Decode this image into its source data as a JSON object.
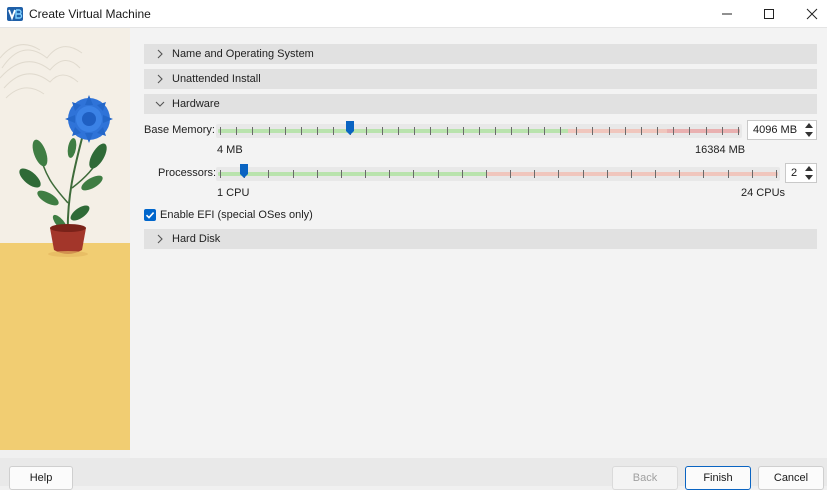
{
  "window": {
    "title": "Create Virtual Machine",
    "controls": [
      "minimize-icon",
      "maximize-icon",
      "close-icon"
    ]
  },
  "sections": {
    "name_os": {
      "label": "Name and Operating System",
      "expanded": false
    },
    "unattended": {
      "label": "Unattended Install",
      "expanded": false
    },
    "hardware": {
      "label": "Hardware",
      "expanded": true
    },
    "hard_disk": {
      "label": "Hard Disk",
      "expanded": false
    }
  },
  "hardware": {
    "base_memory": {
      "label": "Base Memory:",
      "value": "4096 MB",
      "min_label": "4 MB",
      "max_label": "16384 MB",
      "fraction": 0.25
    },
    "processors": {
      "label": "Processors:",
      "value": "2",
      "min_label": "1 CPU",
      "max_label": "24 CPUs",
      "fraction": 0.0435
    },
    "efi": {
      "label": "Enable EFI (special OSes only)",
      "checked": true
    }
  },
  "buttons": {
    "help": "Help",
    "back": "Back",
    "finish": "Finish",
    "cancel": "Cancel"
  },
  "colors": {
    "accent": "#0066cc",
    "slider_ok": "#b9e3ad",
    "slider_warn": "#f0c6bd",
    "section_bg": "#e1e1e1"
  }
}
